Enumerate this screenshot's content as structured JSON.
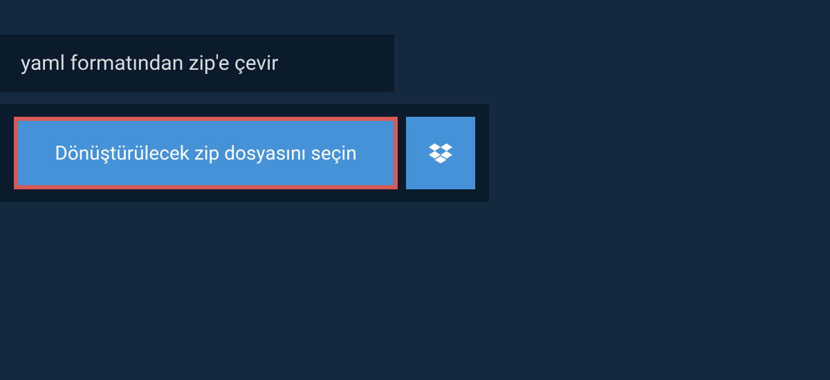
{
  "header": {
    "title": "yaml formatından zip'e çevir"
  },
  "upload": {
    "select_file_label": "Dönüştürülecek zip dosyasını seçin"
  },
  "colors": {
    "background": "#14293e",
    "panel": "#0b1b2b",
    "button": "#4592d8",
    "highlight_border": "#d45b58",
    "text_light": "#d8dde2",
    "text_white": "#ffffff"
  }
}
